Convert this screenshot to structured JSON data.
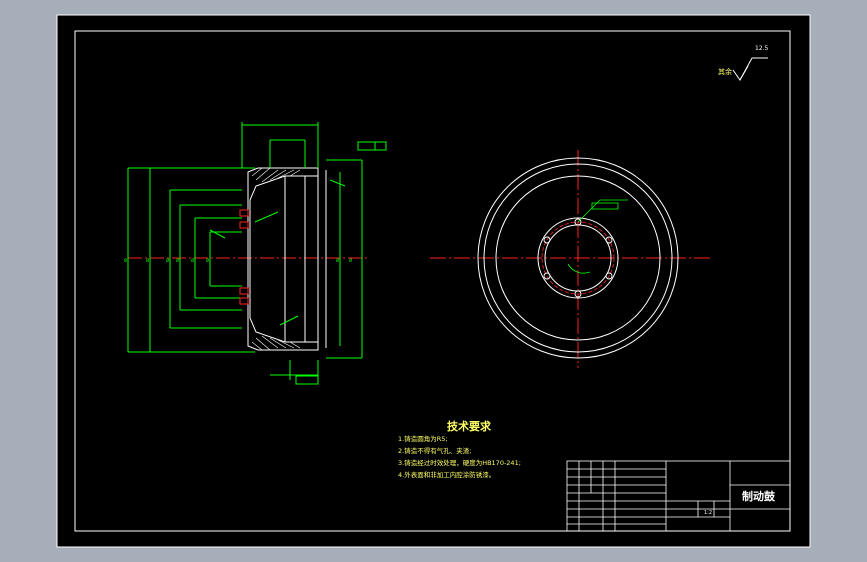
{
  "drawing": {
    "colors": {
      "background": "#a5aeb9",
      "sheet": "#000000",
      "outline": "#ffffff",
      "geometry": "#00ff00",
      "centerline": "#ff2222",
      "text": "#ffff66",
      "dimension": "#00ffff"
    }
  },
  "tech_requirements": {
    "title": "技术要求",
    "items": [
      "1.铸造圆角为R5;",
      "2.铸造不得有气孔、夹渣;",
      "3.铸造经过时效处理，硬度为HB170-241;",
      "4.外表面和非加工内腔涂防锈漆。"
    ]
  },
  "title_block": {
    "part_name": "制动鼓",
    "scale": "1:2"
  },
  "surface_finish": {
    "label": "其余",
    "value": "12.5"
  }
}
